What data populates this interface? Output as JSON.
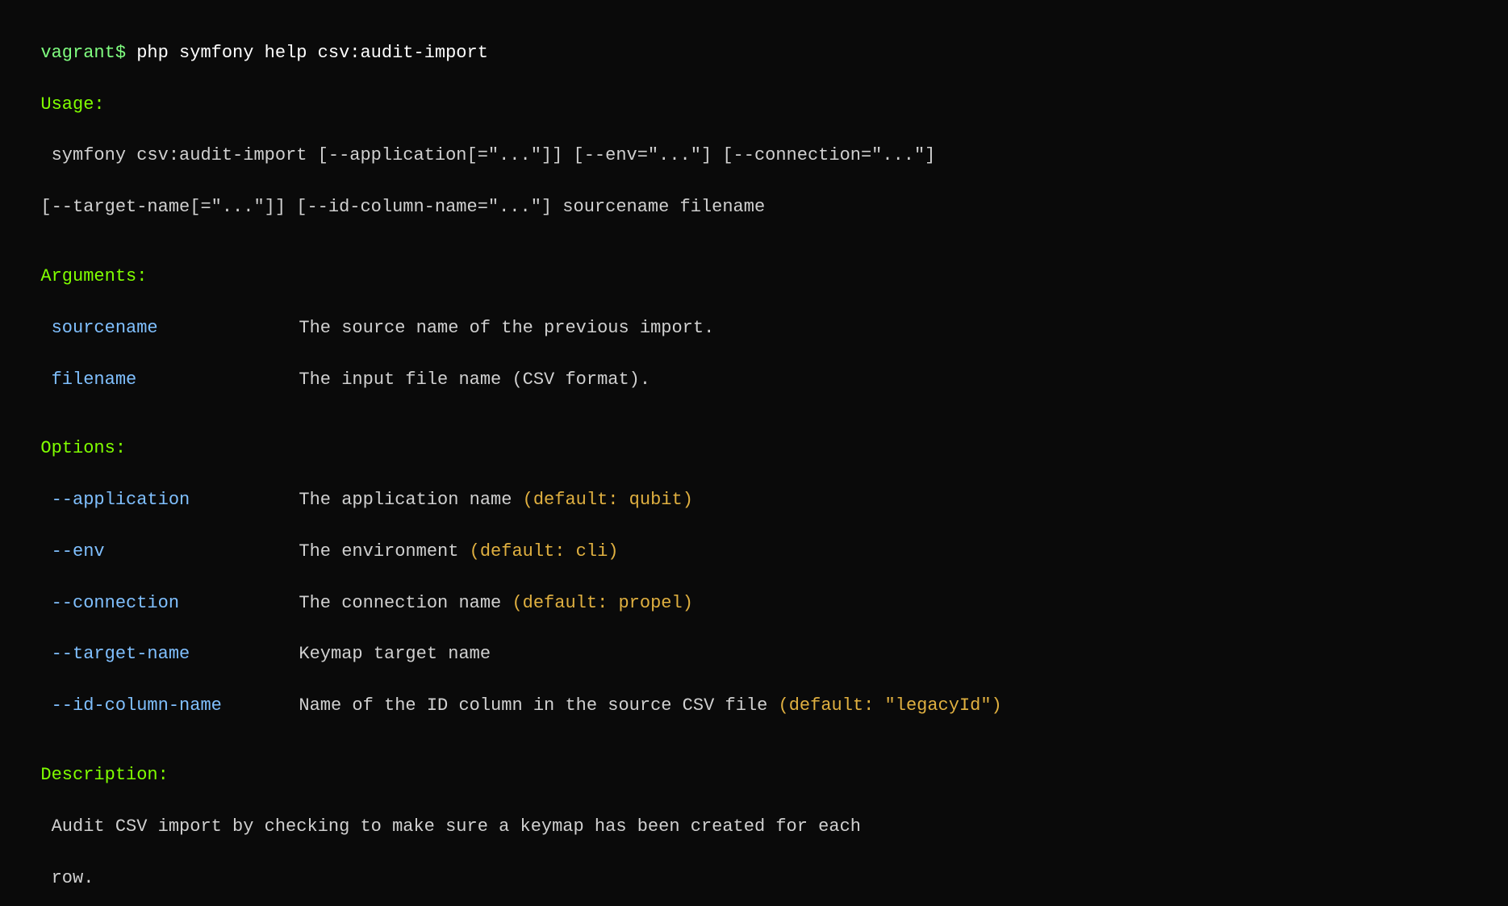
{
  "terminal": {
    "prompt": {
      "user": "vagrant$",
      "command": " php symfony help csv:audit-import"
    },
    "usage_label": "Usage:",
    "usage_lines": [
      " symfony csv:audit-import [--application[=\"...\"]] [--env=\"...\"] [--connection=\"...\"]",
      "[--target-name[=\"...\"]] [--id-column-name=\"...\"] sourcename filename"
    ],
    "arguments_label": "Arguments:",
    "arguments": [
      {
        "name": " sourcename",
        "description": "The source name of the previous import."
      },
      {
        "name": " filename",
        "description": "The input file name (CSV format)."
      }
    ],
    "options_label": "Options:",
    "options": [
      {
        "name": " --application",
        "description": "The application name ",
        "default": "(default: qubit)"
      },
      {
        "name": " --env",
        "description": "The environment ",
        "default": "(default: cli)"
      },
      {
        "name": " --connection",
        "description": "The connection name ",
        "default": "(default: propel)"
      },
      {
        "name": " --target-name",
        "description": "Keymap target name",
        "default": ""
      },
      {
        "name": " --id-column-name",
        "description": "Name of the ID column in the source CSV file ",
        "default": "(default: \"legacyId\")"
      }
    ],
    "description_label": "Description:",
    "description_lines": [
      " Audit CSV import by checking to make sure a keymap has been created for each",
      " row."
    ]
  }
}
